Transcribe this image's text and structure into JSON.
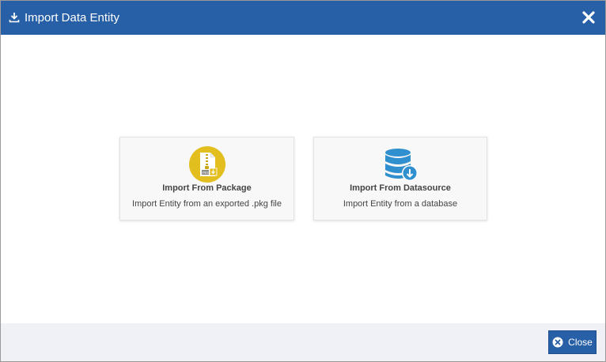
{
  "dialog": {
    "title": "Import Data Entity",
    "title_icon": "download-icon",
    "close_icon": "close-icon"
  },
  "options": [
    {
      "icon": "package-file-icon",
      "title": "Import From Package",
      "description": "Import Entity from an exported .pkg file",
      "icon_color": "#e2be1e"
    },
    {
      "icon": "database-download-icon",
      "title": "Import From Datasource",
      "description": "Import Entity from a database",
      "icon_color": "#2f8fcf"
    }
  ],
  "footer": {
    "close_label": "Close",
    "close_icon": "circle-x-icon"
  },
  "colors": {
    "header": "#2860a8",
    "footer_bg": "#eff1f7",
    "button": "#2860a8"
  }
}
